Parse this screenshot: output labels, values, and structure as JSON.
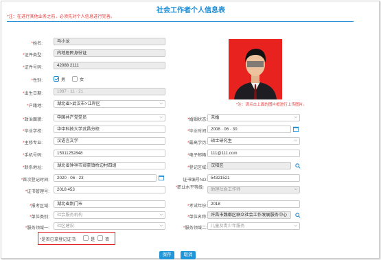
{
  "title": "社会工作者个人信息表",
  "top_note": "*注：在进行其他业务之前，必须先对个人信息进行完善。",
  "photo": {
    "note": "*注：请点击上面的图片框进行上传图片。"
  },
  "left": {
    "name": {
      "label": "姓名:",
      "value": "马小龙"
    },
    "id_type": {
      "label": "证件类型:",
      "value": "内地居民身份证"
    },
    "id_number": {
      "label": "证件号码:",
      "value": "42088        2111"
    },
    "gender": {
      "label": "性别:",
      "male": "男",
      "female": "女"
    },
    "birthdate": {
      "label": "出生日期:",
      "value": "1987 · 11 · 21"
    },
    "hukou": {
      "label": "户籍地:",
      "value": "湖北省>武汉市>江岸区"
    },
    "political": {
      "label": "政治面貌:",
      "value": "中国共产党党员"
    },
    "school": {
      "label": "毕业学校:",
      "value": "华中科技大学武昌分校"
    },
    "major": {
      "label": "主修专业:",
      "value": "汉语言文学"
    },
    "mobile": {
      "label": "手机号码:",
      "value": "15011252848"
    },
    "address": {
      "label": "联系地址:",
      "value": "湖北省钟祥市郢豪镇桥边村四组"
    },
    "first_reg_date": {
      "label": "首次登记时间:",
      "value": "2020 · 06 · 23"
    },
    "cert_number": {
      "label": "证书管理号:",
      "value": "2018           453"
    },
    "exam_area": {
      "label": "报考区域:",
      "value": "湖北省荆门市"
    },
    "unit_type": {
      "label": "单位类别:",
      "value": "社会服务机构"
    },
    "service_area1": {
      "label": "服务领域一:",
      "value": "社区建设"
    },
    "has_cert": {
      "label": "是否已拿登记证书:",
      "yes": "是",
      "no": "否"
    }
  },
  "right": {
    "marital": {
      "label": "婚姻状态:",
      "value": "未婚"
    },
    "grad_time": {
      "label": "毕业时间:",
      "value": "2008 · 06 · 30"
    },
    "education": {
      "label": "最高学历:",
      "value": "硕士研究生"
    },
    "email": {
      "label": "电子邮箱:",
      "value": "111@111.com"
    },
    "reg_area": {
      "label": "登记区域:",
      "value": "汉阳区"
    },
    "cert_no": {
      "label": "证书编号NO:",
      "value": "54321521"
    },
    "level": {
      "label": "职业水平等级:",
      "value": "助理社会工作师"
    },
    "exam_time": {
      "label": "考试年份:",
      "value": "2018"
    },
    "unit_name": {
      "label": "单位名称:",
      "value": "许昌市魏都区联众社会工作发展服务中心"
    },
    "service_area2": {
      "label": "服务领域二:",
      "value": "儿童及青少年服务"
    }
  },
  "buttons": {
    "save": "保存",
    "cancel": "取消"
  },
  "colors": {
    "accent": "#1c8bd3",
    "required": "#e23b3b",
    "highlight": "#e02020"
  }
}
